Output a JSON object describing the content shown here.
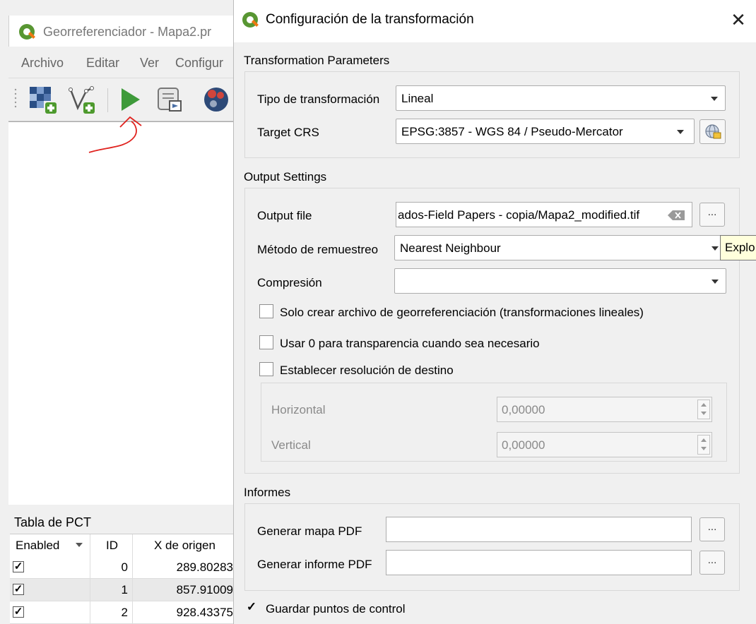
{
  "background_window": {
    "title": "Georreferenciador - Mapa2.pr",
    "menu": [
      "Archivo",
      "Editar",
      "Ver",
      "Configur"
    ],
    "toolbar_icons": [
      "raster-layer-add-icon",
      "vector-layer-add-icon",
      "start-georeferencing-icon",
      "generate-script-icon",
      "transform-settings-icon"
    ],
    "pct_table": {
      "title": "Tabla de PCT",
      "columns": [
        "Enabled",
        "ID",
        "X de origen"
      ],
      "rows": [
        {
          "enabled": true,
          "id": "0",
          "x": "289.80283"
        },
        {
          "enabled": true,
          "id": "1",
          "x": "857.91009"
        },
        {
          "enabled": true,
          "id": "2",
          "x": "928.43375"
        }
      ]
    }
  },
  "dialog": {
    "title": "Configuración de la transformación",
    "close": "✕",
    "transformation_parameters": {
      "section": "Transformation Parameters",
      "type_label": "Tipo de transformación",
      "type_value": "Lineal",
      "crs_label": "Target CRS",
      "crs_value": "EPSG:3857 - WGS 84 / Pseudo-Mercator"
    },
    "output_settings": {
      "section": "Output Settings",
      "output_file_label": "Output file",
      "output_file_value": "ados-Field Papers - copia/Mapa2_modified.tif",
      "browse": "...",
      "resampling_label": "Método de remuestreo",
      "resampling_value": "Nearest Neighbour",
      "compression_label": "Compresión",
      "compression_value": "",
      "check_world_file": "Solo crear archivo de georreferenciación (transformaciones lineales)",
      "check_transparency": "Usar 0 para transparencia cuando sea necesario",
      "check_resolution": "Establecer resolución de destino",
      "horizontal_label": "Horizontal",
      "horizontal_value": "0,00000",
      "vertical_label": "Vertical",
      "vertical_value": "0,00000"
    },
    "reports": {
      "section": "Informes",
      "pdf_map_label": "Generar mapa PDF",
      "pdf_map_value": "",
      "pdf_report_label": "Generar informe PDF",
      "pdf_report_value": "",
      "browse": "..."
    },
    "save_gcp_label": "Guardar puntos de control",
    "save_gcp_checked": true
  },
  "tooltip": "Explo"
}
